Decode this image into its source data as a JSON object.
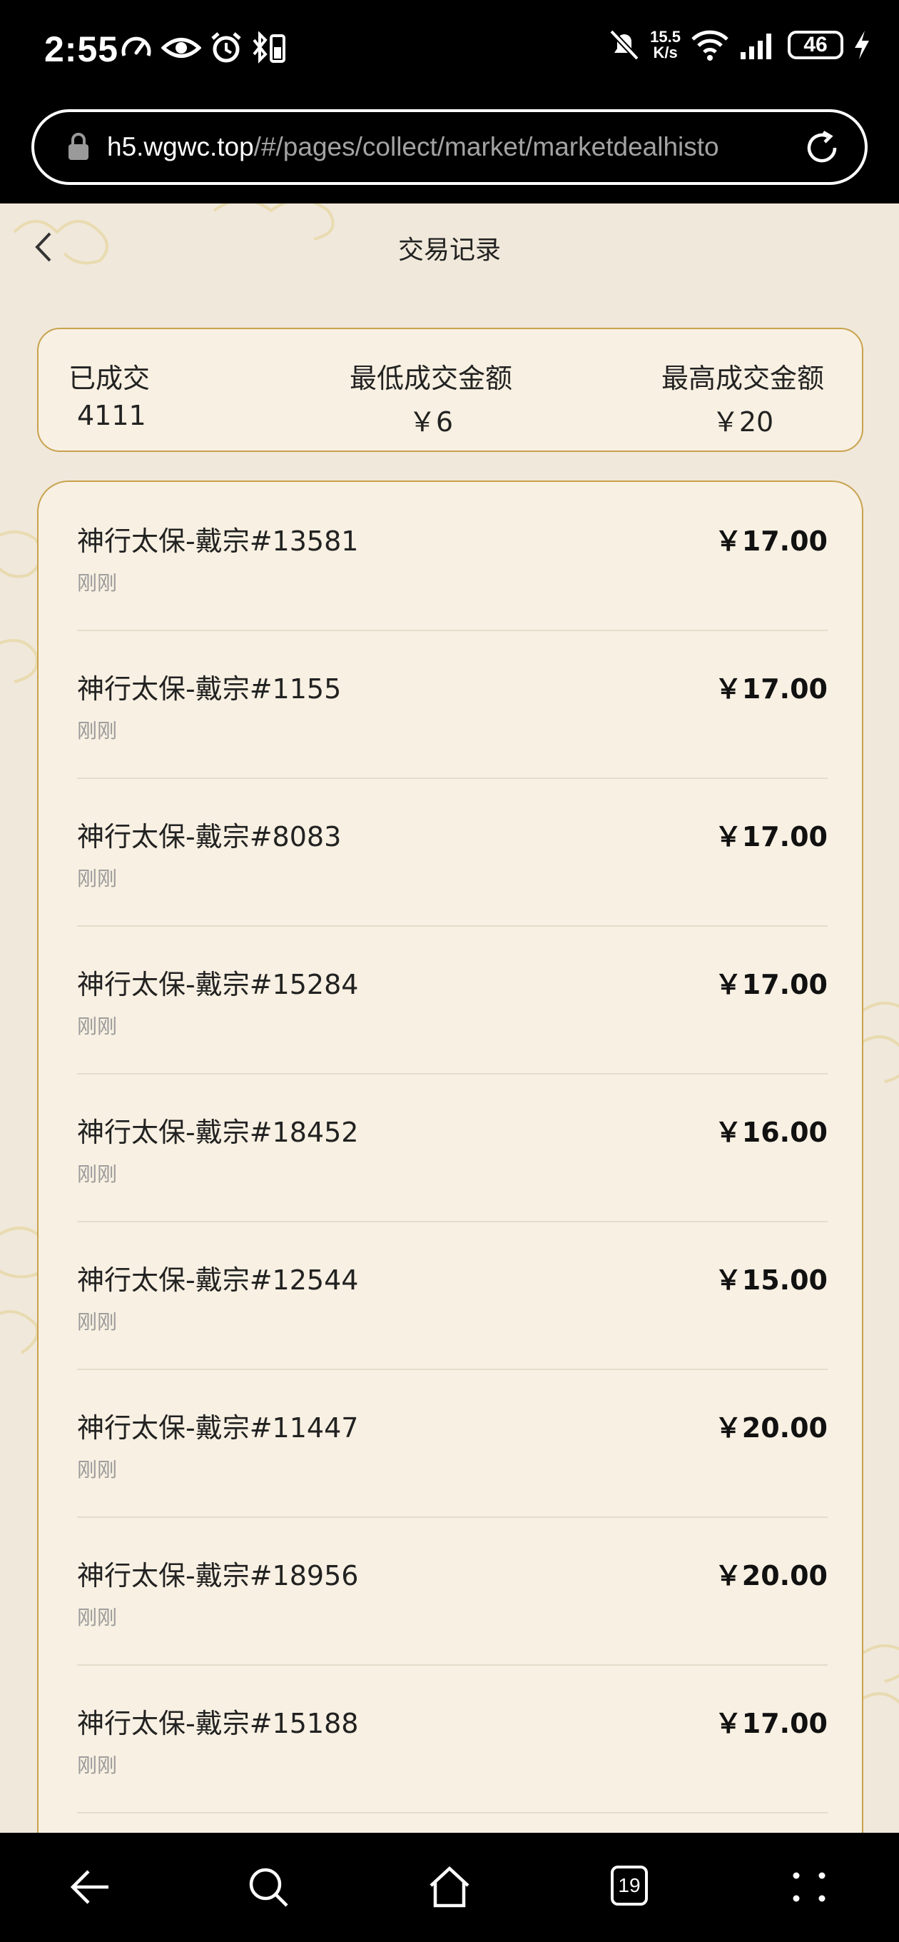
{
  "status_bar": {
    "time": "2:55",
    "net_speed_value": "15.5",
    "net_speed_unit": "K/s",
    "battery": "46"
  },
  "browser": {
    "url_host": "h5.wgwc.top",
    "url_path": "/#/pages/collect/market/marketdealhisto"
  },
  "header": {
    "title": "交易记录"
  },
  "summary": {
    "deals_label": "已成交",
    "deals_value": "4111",
    "min_label": "最低成交金额",
    "min_value": "￥6",
    "max_label": "最高成交金额",
    "max_value": "￥20"
  },
  "records": [
    {
      "name": "神行太保-戴宗#13581",
      "time": "刚刚",
      "price": "￥17.00"
    },
    {
      "name": "神行太保-戴宗#1155",
      "time": "刚刚",
      "price": "￥17.00"
    },
    {
      "name": "神行太保-戴宗#8083",
      "time": "刚刚",
      "price": "￥17.00"
    },
    {
      "name": "神行太保-戴宗#15284",
      "time": "刚刚",
      "price": "￥17.00"
    },
    {
      "name": "神行太保-戴宗#18452",
      "time": "刚刚",
      "price": "￥16.00"
    },
    {
      "name": "神行太保-戴宗#12544",
      "time": "刚刚",
      "price": "￥15.00"
    },
    {
      "name": "神行太保-戴宗#11447",
      "time": "刚刚",
      "price": "￥20.00"
    },
    {
      "name": "神行太保-戴宗#18956",
      "time": "刚刚",
      "price": "￥20.00"
    },
    {
      "name": "神行太保-戴宗#15188",
      "time": "刚刚",
      "price": "￥17.00"
    }
  ],
  "bottom_nav": {
    "tab_count": "19"
  },
  "colors": {
    "page_background": "#f0e8da",
    "card_background": "#f8f0e2",
    "card_border": "#c8a24e"
  }
}
